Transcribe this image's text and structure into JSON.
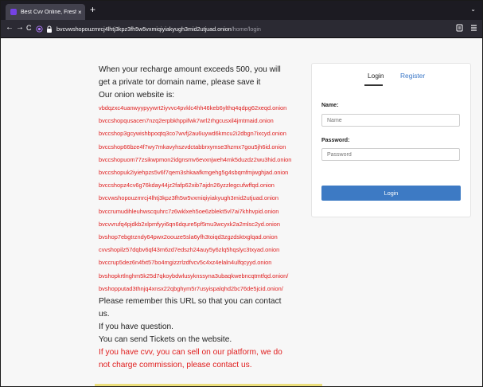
{
  "browser": {
    "tab_title": "Best Cvv Online, Fresh CVV | ...",
    "tab_close": "×",
    "newtab_label": "+",
    "tabs_menu": "⌄",
    "back": "←",
    "forward": "→",
    "reload": "C",
    "url_host": "bvcvwshopouzmrcj4lhtj3kpz3fh5w5vxmiqiyiakyugh3mid2utjuad.onion",
    "url_path": "/home/login"
  },
  "info": {
    "intro1": "When your recharge amount exceeds 500, you will",
    "intro2": "get a private tor domain name, please save it",
    "intro3": "Our onion website is:",
    "links": [
      "vbdqzxc4uanwyypyywrt2iyvvc4pvklc4hh46keb6ylthq4qdpg62xeqd.onion",
      "bvccshopqusacen7nzq2erpbkhppifwk7wrl2rhgcusxil4jmtmaid.onion",
      "bvccshop3gcywishbpoqtq3co7wvfj2au6uywd6kmcu2i2dbgn7ixcyd.onion",
      "bvccshop66bze4f7wy7mkavyhszvdctabbrxymse3hzmx7gou5jh6id.onion",
      "bvccshopuom77zsikwpmon2idgnsmv6evxnjweh4mk5duzdz2wu3hid.onion",
      "bvccshopuk2iyiehpzs5v6f7qem3shkaafkmgehg5g4sbqmfmjwghjad.onion",
      "bvccshopz4cv6g76kday44jz2fafp62xib7ajdn26yzzlegcufwffqd.onion",
      "bvcvwshopouzmrcj4lhtj3kpz3fh5w5vxmiqiyiakyugh3mid2utjuad.onion",
      "bvccrumudihleuhwscquhrc7z6wklxeh5oe6zblekt5vl7ai7khhvpid.onion",
      "bvcvvrufq4pjdkb2xlpmfyyi6qn6dqure5pf5mu3wcyxk2a2mlsc2yd.onion",
      "bvshop7ebgtrzndy64pwx2oouze5sla6yfh3toiqd3zgzdsktxglqad.onion",
      "cvvshopilz57dqbv6qf43m6zd7edszh24auy5y6zlq5hqslyc3txyad.onion",
      "bvccrup5dez6n4fxt57bo4mgizzrlzdfvcv5c4xz4elaln4ulfqcyyd.onion",
      "bvshopkrtlnghm5k25d7qkoybdwlusyknssyna3ubaqkwebncqtmtfqd.onion/",
      "bvshopputad3thnjq4xnsx22qbghym5r7usyispalqhd2bc76de5jcid.onion/"
    ],
    "remember1": "Please remember this URL so that you can contact",
    "remember2": "us.",
    "question": "If you have question.",
    "tickets": "You can send Tickets on the website.",
    "sell1": "If you have cvv, you can sell on our platform, we do",
    "sell2": "not charge commission, please contact us."
  },
  "login": {
    "tab_login": "Login",
    "tab_register": "Register",
    "name_label": "Name:",
    "name_placeholder": "Name",
    "password_label": "Password:",
    "password_placeholder": "Password",
    "submit_label": "Login"
  }
}
